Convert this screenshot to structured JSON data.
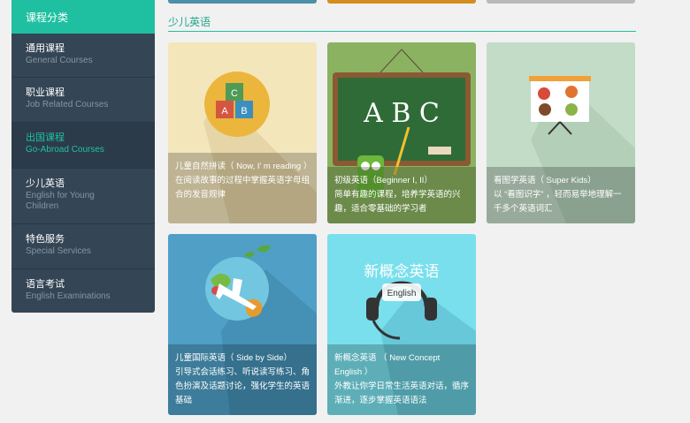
{
  "sidebar": {
    "header": "课程分类",
    "items": [
      {
        "zh": "通用课程",
        "en": "General Courses"
      },
      {
        "zh": "职业课程",
        "en": "Job Related Courses"
      },
      {
        "zh": "出国课程",
        "en": "Go-Abroad Courses"
      },
      {
        "zh": "少儿英语",
        "en": "English for Young Children"
      },
      {
        "zh": "特色服务",
        "en": "Special Services"
      },
      {
        "zh": "语言考试",
        "en": "English Examinations"
      }
    ]
  },
  "section": {
    "title": "少儿英语"
  },
  "cards": [
    {
      "title": "儿童自然拼读（ Now, I’ m reading ）",
      "desc": "在阅读故事的过程中掌握英语字母组合的发音规律"
    },
    {
      "title": "初级英语（Beginner I, II）",
      "desc": "简单有趣的课程，培养学英语的兴趣，适合零基础的学习者"
    },
    {
      "title": "看图学英语（ Super Kids）",
      "desc": "以 “看图识字” ，轻而易举地理解一千多个英语词汇"
    },
    {
      "title": "儿童国际英语（ Side by Side）",
      "desc": "引导式会话练习、听说读写练习、角色扮演及话题讨论，强化学生的英语基础"
    },
    {
      "title": "新概念英语 （ New Concept English ）",
      "desc": "外教让你学日常生活英语对话，循序渐进，逐步掌握英语语法"
    }
  ],
  "art": {
    "blocks": [
      "C",
      "A",
      "B"
    ],
    "board": "A B C",
    "poster_title": "新概念英语",
    "poster_sub": "English"
  }
}
